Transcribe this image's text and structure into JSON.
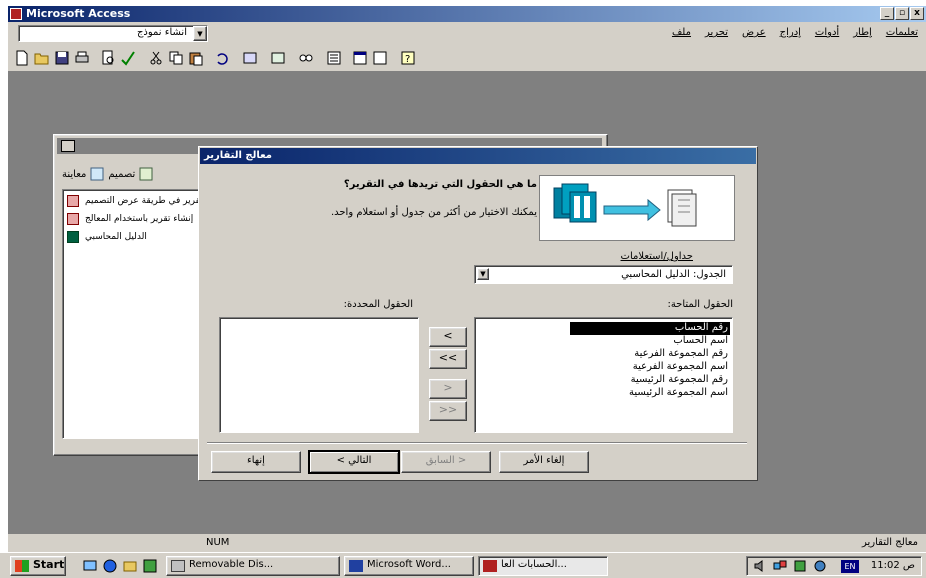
{
  "app": {
    "title": "Microsoft Access",
    "window_controls": [
      "_",
      "▫",
      "x"
    ]
  },
  "menubar": {
    "combo_value": "انشاء نموذج",
    "items": [
      "ملف",
      "تحرير",
      "عرض",
      "إدراج",
      "أدوات",
      "إطار",
      "تعليمات"
    ]
  },
  "toolbar": {
    "icons": [
      "new-icon",
      "open-icon",
      "save-icon",
      "print-icon",
      "preview-icon",
      "spelling-icon",
      "cut-icon",
      "copy-icon",
      "paste-icon",
      "undo-icon",
      "office-links-icon",
      "analyze-icon",
      "relationships-icon",
      "properties-icon",
      "database-window-icon",
      "new-object-icon",
      "help-icon"
    ]
  },
  "db_window": {
    "toolbar": {
      "preview": "معاينة",
      "design": "تصميم"
    },
    "items": [
      {
        "label": "إنشاء تقرير في طريقة عرض التصميم",
        "icon": "wizard-icon"
      },
      {
        "label": "إنشاء تقرير باستخدام المعالج",
        "icon": "wizard-icon"
      },
      {
        "label": "الدليل المحاسبي",
        "icon": "report-icon"
      }
    ]
  },
  "wizard": {
    "title": "معالج التقارير",
    "question": "ما هي الحقول التي تريدها في التقرير؟",
    "hint": "يمكنك الاختيار من أكثر من جدول أو استعلام واحد.",
    "tables_label": "جداول/استعلامات",
    "tables_value": "الجدول: الدليل المحاسبي",
    "available_label": "الحقول المتاحة:",
    "selected_label": "الحقول المحددة:",
    "available_fields": [
      "رقم الحساب",
      "اسم الحساب",
      "رقم المجموعة الفرعية",
      "اسم المجموعة الفرعية",
      "رقم المجموعة الرئيسية",
      "اسم المجموعة الرئيسية"
    ],
    "selected_fields": [],
    "move_buttons": {
      "add_one": "<",
      "add_all": "<<",
      "remove_one": ">",
      "remove_all": ">>"
    },
    "buttons": {
      "finish": "إنهاء",
      "next": "التالي >",
      "back": "< السابق",
      "cancel": "إلغاء الأمر"
    }
  },
  "statusbar": {
    "num": "NUM",
    "text": "معالج التقارير"
  },
  "taskbar": {
    "start": "Start",
    "tasks": [
      "Removable Dis...",
      "Microsoft Word...",
      "الحسابات العا..."
    ],
    "lang": "EN",
    "clock": "11:02 ص"
  }
}
